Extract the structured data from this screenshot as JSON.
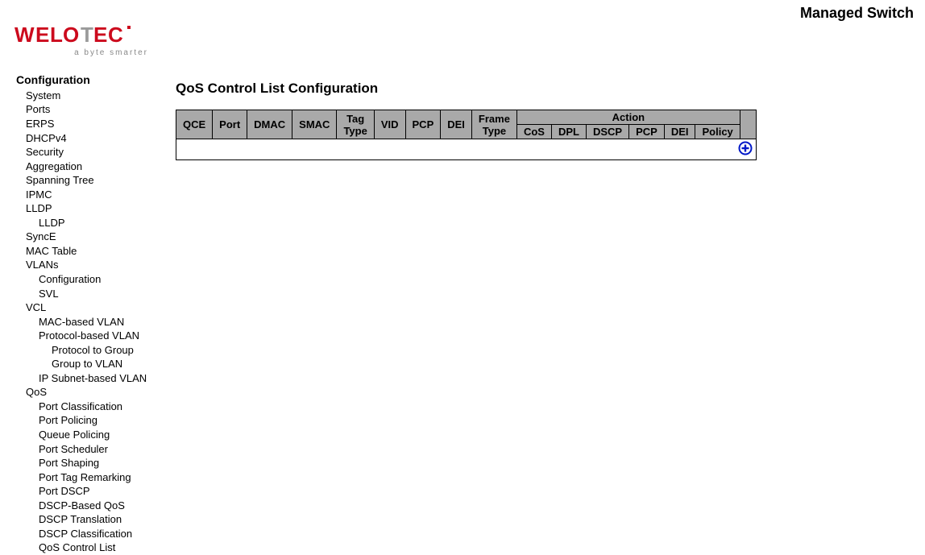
{
  "header": {
    "product_title": "Managed Switch",
    "logo_alt": "WELOTEC",
    "tagline": "a byte smarter"
  },
  "sidebar": {
    "heading": "Configuration",
    "items": [
      {
        "label": "System",
        "level": 1
      },
      {
        "label": "Ports",
        "level": 1
      },
      {
        "label": "ERPS",
        "level": 1
      },
      {
        "label": "DHCPv4",
        "level": 1
      },
      {
        "label": "Security",
        "level": 1
      },
      {
        "label": "Aggregation",
        "level": 1
      },
      {
        "label": "Spanning Tree",
        "level": 1
      },
      {
        "label": "IPMC",
        "level": 1
      },
      {
        "label": "LLDP",
        "level": 1
      },
      {
        "label": "LLDP",
        "level": 2
      },
      {
        "label": "SyncE",
        "level": 1
      },
      {
        "label": "MAC Table",
        "level": 1
      },
      {
        "label": "VLANs",
        "level": 1
      },
      {
        "label": "Configuration",
        "level": 2
      },
      {
        "label": "SVL",
        "level": 2
      },
      {
        "label": "VCL",
        "level": 1
      },
      {
        "label": "MAC-based VLAN",
        "level": 2
      },
      {
        "label": "Protocol-based VLAN",
        "level": 2
      },
      {
        "label": "Protocol to Group",
        "level": 3
      },
      {
        "label": "Group to VLAN",
        "level": 3
      },
      {
        "label": "IP Subnet-based VLAN",
        "level": 2
      },
      {
        "label": "QoS",
        "level": 1
      },
      {
        "label": "Port Classification",
        "level": 2
      },
      {
        "label": "Port Policing",
        "level": 2
      },
      {
        "label": "Queue Policing",
        "level": 2
      },
      {
        "label": "Port Scheduler",
        "level": 2
      },
      {
        "label": "Port Shaping",
        "level": 2
      },
      {
        "label": "Port Tag Remarking",
        "level": 2
      },
      {
        "label": "Port DSCP",
        "level": 2
      },
      {
        "label": "DSCP-Based QoS",
        "level": 2
      },
      {
        "label": "DSCP Translation",
        "level": 2
      },
      {
        "label": "DSCP Classification",
        "level": 2
      },
      {
        "label": "QoS Control List",
        "level": 2
      }
    ]
  },
  "main": {
    "title": "QoS Control List Configuration",
    "table": {
      "group_header_action": "Action",
      "columns_main": [
        "QCE",
        "Port",
        "DMAC",
        "SMAC",
        "Tag Type",
        "VID",
        "PCP",
        "DEI",
        "Frame Type"
      ],
      "columns_action": [
        "CoS",
        "DPL",
        "DSCP",
        "PCP",
        "DEI",
        "Policy"
      ]
    }
  }
}
